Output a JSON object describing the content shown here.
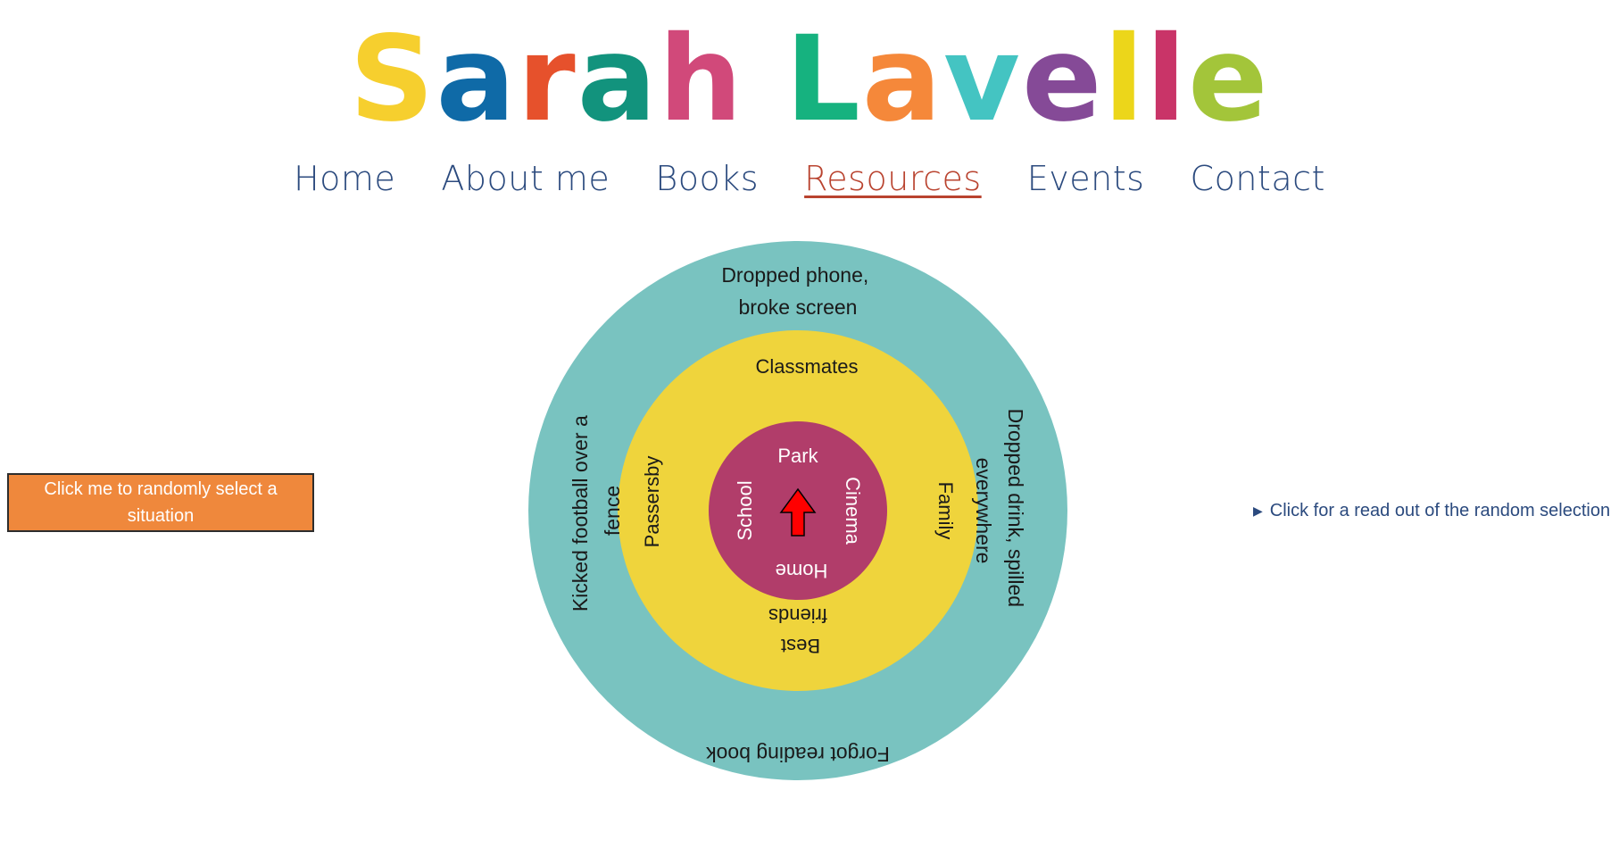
{
  "logo": {
    "letters": [
      "S",
      "a",
      "r",
      "a",
      "h",
      " ",
      "L",
      "a",
      "v",
      "e",
      "l",
      "l",
      "e"
    ],
    "colors": [
      "#f6cf2e",
      "#0f6aa7",
      "#e6512c",
      "#12937d",
      "#d1497a",
      "",
      "#16b27f",
      "#f5883a",
      "#44c4c2",
      "#854a97",
      "#ecd61a",
      "#c93468",
      "#a3c53a"
    ]
  },
  "nav": {
    "items": [
      "Home",
      "About me",
      "Books",
      "Resources",
      "Events",
      "Contact"
    ],
    "active_index": 3
  },
  "random_button": {
    "label": "Click me to randomly select a situation"
  },
  "readout": {
    "label": "Click for a read out of the random selection"
  },
  "wheel": {
    "colors": {
      "outer": "#79c3c0",
      "middle": "#efd43c",
      "inner": "#b13d6a",
      "arrow": "#ff0000"
    },
    "outer": {
      "top": [
        "Dropped phone,",
        "broke screen"
      ],
      "right": [
        "Dropped drink, spilled",
        "everywhere"
      ],
      "bottom": [
        "Forgot reading book"
      ],
      "left": [
        "Kicked football over a",
        "fence"
      ]
    },
    "middle": {
      "top": [
        "Classmates"
      ],
      "right": [
        "Family"
      ],
      "bottom": [
        "Best",
        "friends"
      ],
      "left": [
        "Passersby"
      ]
    },
    "inner": {
      "top": [
        "Park"
      ],
      "right": [
        "Cinema"
      ],
      "bottom": [
        "Home"
      ],
      "left": [
        "School"
      ]
    }
  }
}
